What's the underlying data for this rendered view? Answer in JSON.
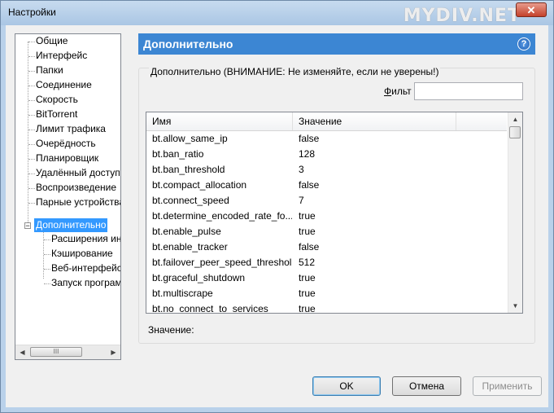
{
  "window": {
    "title": "Настройки",
    "watermark": "MYDIV.NET",
    "close_glyph": "✕"
  },
  "tree": {
    "items": [
      {
        "label": "Общие"
      },
      {
        "label": "Интерфейс"
      },
      {
        "label": "Папки"
      },
      {
        "label": "Соединение"
      },
      {
        "label": "Скорость"
      },
      {
        "label": "BitTorrent"
      },
      {
        "label": "Лимит трафика"
      },
      {
        "label": "Очерёдность"
      },
      {
        "label": "Планировщик"
      },
      {
        "label": "Удалённый доступ"
      },
      {
        "label": "Воспроизведение"
      },
      {
        "label": "Парные устройства"
      },
      {
        "label": "Дополнительно"
      }
    ],
    "children": [
      {
        "label": "Расширения интерфейса"
      },
      {
        "label": "Кэширование"
      },
      {
        "label": "Веб-интерфейс"
      },
      {
        "label": "Запуск программ"
      }
    ],
    "expander_glyph": "−",
    "scroll_left": "◀",
    "scroll_right": "▶",
    "scroll_thumb": "III"
  },
  "header": {
    "title": "Дополнительно",
    "help_glyph": "?"
  },
  "group": {
    "label": "Дополнительно (ВНИМАНИЕ: Не изменяйте, если не уверены!)",
    "filter_label_prefix": "Ф",
    "filter_label_rest": "ильт",
    "filter_value": "",
    "value_label": "Значение:"
  },
  "table": {
    "columns": [
      "Имя",
      "Значение"
    ],
    "rows": [
      {
        "name": "bt.allow_same_ip",
        "value": "false"
      },
      {
        "name": "bt.ban_ratio",
        "value": "128"
      },
      {
        "name": "bt.ban_threshold",
        "value": "3"
      },
      {
        "name": "bt.compact_allocation",
        "value": "false"
      },
      {
        "name": "bt.connect_speed",
        "value": "7"
      },
      {
        "name": "bt.determine_encoded_rate_fo...",
        "value": "true"
      },
      {
        "name": "bt.enable_pulse",
        "value": "true"
      },
      {
        "name": "bt.enable_tracker",
        "value": "false"
      },
      {
        "name": "bt.failover_peer_speed_threshold",
        "value": "512"
      },
      {
        "name": "bt.graceful_shutdown",
        "value": "true"
      },
      {
        "name": "bt.multiscrape",
        "value": "true"
      },
      {
        "name": "bt.no_connect_to_services",
        "value": "true"
      }
    ],
    "scroll_up": "▲",
    "scroll_down": "▼"
  },
  "buttons": {
    "ok": "OK",
    "cancel": "Отмена",
    "apply": "Применить"
  },
  "colors": {
    "header_bg": "#3c86d3",
    "selection_bg": "#3399ff",
    "frame": "#b9d1ea"
  }
}
